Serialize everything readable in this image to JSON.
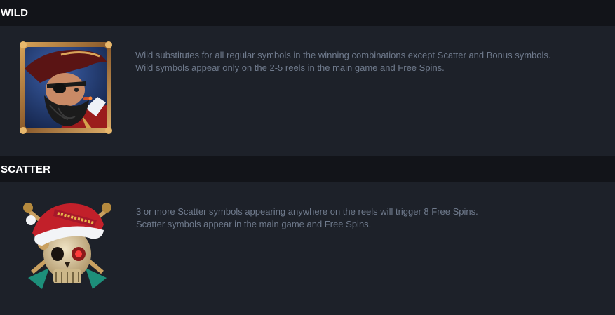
{
  "wild": {
    "title": "WILD",
    "symbol_icon": "pirate-captain-wild-icon",
    "description": [
      "Wild substitutes for all regular symbols in the winning combinations except Scatter and Bonus symbols.",
      "Wild symbols appear only on the 2-5 reels in the main game and Free Spins."
    ]
  },
  "scatter": {
    "title": "SCATTER",
    "symbol_icon": "santa-hat-skull-scatter-icon",
    "description": [
      "3 or more Scatter symbols appearing anywhere on the reels will trigger 8 Free Spins.",
      "Scatter symbols appear in the main game and Free Spins."
    ]
  },
  "colors": {
    "page_bg": "#1d2129",
    "header_bg": "#121419",
    "header_text": "#ffffff",
    "body_text": "#6f7a8c"
  }
}
